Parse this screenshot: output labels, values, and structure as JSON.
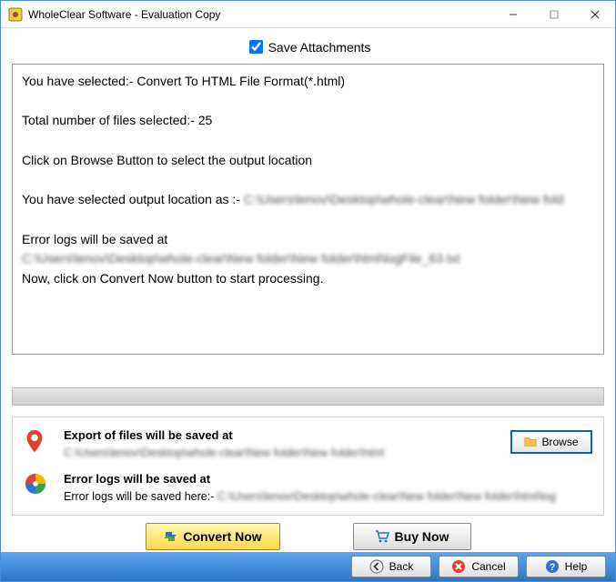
{
  "window": {
    "title": "WholeClear Software - Evaluation Copy"
  },
  "save_attachments": {
    "label": "Save Attachments",
    "checked": true
  },
  "log": {
    "line1": "You have selected:- Convert To HTML File Format(*.html)",
    "line2": "Total number of files selected:- 25",
    "line3": "Click on Browse Button to select the output location",
    "line4_prefix": "You have selected output location as :- ",
    "line4_path": "C:\\Users\\lenov\\Desktop\\whole-clear\\New folder\\New fold",
    "line5": "Error logs will be saved at",
    "line5_path": "C:\\Users\\lenov\\Desktop\\whole-clear\\New folder\\New folder\\html\\logFile_63.txt",
    "line6": "Now, click on Convert Now button to start processing."
  },
  "export": {
    "title": "Export of files will be saved at",
    "path": "C:\\Users\\lenov\\Desktop\\whole-clear\\New folder\\New folder\\html",
    "browse_label": "Browse"
  },
  "errorlogs": {
    "title": "Error logs will be saved at",
    "prefix": "Error logs will be saved here:- ",
    "path": "C:\\Users\\lenov\\Desktop\\whole-clear\\New folder\\New folder\\html\\log"
  },
  "buttons": {
    "convert": "Convert Now",
    "buy": "Buy Now",
    "back": "Back",
    "cancel": "Cancel",
    "help": "Help"
  }
}
